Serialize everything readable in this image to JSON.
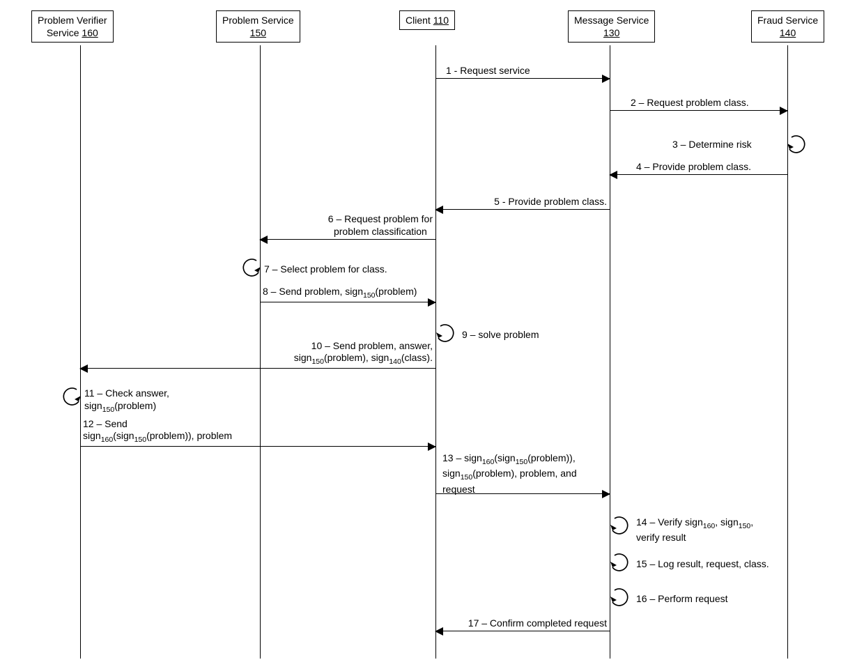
{
  "actors": {
    "verifier": {
      "name": "Problem Verifier",
      "service_word": "Service",
      "id": "160"
    },
    "problem": {
      "name": "Problem Service",
      "id": "150"
    },
    "client": {
      "name": "Client",
      "id": "110"
    },
    "message": {
      "name": "Message Service",
      "id": "130"
    },
    "fraud": {
      "name": "Fraud Service",
      "id": "140"
    }
  },
  "messages": {
    "m1": "1 - Request service",
    "m2": "2 – Request problem class.",
    "m3": "3 – Determine risk",
    "m4": "4 – Provide problem class.",
    "m5": "5 -  Provide problem class.",
    "m6a": "6 – Request problem for",
    "m6b": "problem classification",
    "m7": "7 – Select problem for class.",
    "m8": "8 – Send problem, sign<sub>150</sub>(problem)",
    "m9": "9 – solve problem",
    "m10a": "10 – Send problem, answer,",
    "m10b": "sign<sub>150</sub>(problem), sign<sub>140</sub>(class).",
    "m11a": "11 – Check answer,",
    "m11b": "sign<sub>150</sub>(problem)",
    "m12a": "12 – Send",
    "m12b": "sign<sub>160</sub>(sign<sub>150</sub>(problem)), problem",
    "m13a": "13 – sign<sub>160</sub>(sign<sub>150</sub>(problem)),",
    "m13b": "sign<sub>150</sub>(problem), problem, and",
    "m13c": "request",
    "m14a": "14 – Verify sign<sub>160</sub>,  sign<sub>150</sub>,",
    "m14b": "verify result",
    "m15": "15 – Log result, request, class.",
    "m16": "16 – Perform request",
    "m17": "17 – Confirm completed request"
  },
  "chart_data": {
    "type": "sequence-diagram",
    "actors": [
      {
        "id": "160",
        "name": "Problem Verifier Service"
      },
      {
        "id": "150",
        "name": "Problem Service"
      },
      {
        "id": "110",
        "name": "Client"
      },
      {
        "id": "130",
        "name": "Message Service"
      },
      {
        "id": "140",
        "name": "Fraud Service"
      }
    ],
    "steps": [
      {
        "n": 1,
        "from": "110",
        "to": "130",
        "label": "Request service"
      },
      {
        "n": 2,
        "from": "130",
        "to": "140",
        "label": "Request problem class."
      },
      {
        "n": 3,
        "from": "140",
        "to": "140",
        "label": "Determine risk"
      },
      {
        "n": 4,
        "from": "140",
        "to": "130",
        "label": "Provide problem class."
      },
      {
        "n": 5,
        "from": "130",
        "to": "110",
        "label": "Provide problem class."
      },
      {
        "n": 6,
        "from": "110",
        "to": "150",
        "label": "Request problem for problem classification"
      },
      {
        "n": 7,
        "from": "150",
        "to": "150",
        "label": "Select problem for class."
      },
      {
        "n": 8,
        "from": "150",
        "to": "110",
        "label": "Send problem, sign150(problem)"
      },
      {
        "n": 9,
        "from": "110",
        "to": "110",
        "label": "solve problem"
      },
      {
        "n": 10,
        "from": "110",
        "to": "160",
        "label": "Send problem, answer, sign150(problem), sign140(class)."
      },
      {
        "n": 11,
        "from": "160",
        "to": "160",
        "label": "Check answer, sign150(problem)"
      },
      {
        "n": 12,
        "from": "160",
        "to": "110",
        "label": "Send sign160(sign150(problem)), problem"
      },
      {
        "n": 13,
        "from": "110",
        "to": "130",
        "label": "sign160(sign150(problem)), sign150(problem), problem, and request"
      },
      {
        "n": 14,
        "from": "130",
        "to": "130",
        "label": "Verify sign160, sign150, verify result"
      },
      {
        "n": 15,
        "from": "130",
        "to": "130",
        "label": "Log result, request, class."
      },
      {
        "n": 16,
        "from": "130",
        "to": "130",
        "label": "Perform request"
      },
      {
        "n": 17,
        "from": "130",
        "to": "110",
        "label": "Confirm completed request"
      }
    ]
  }
}
